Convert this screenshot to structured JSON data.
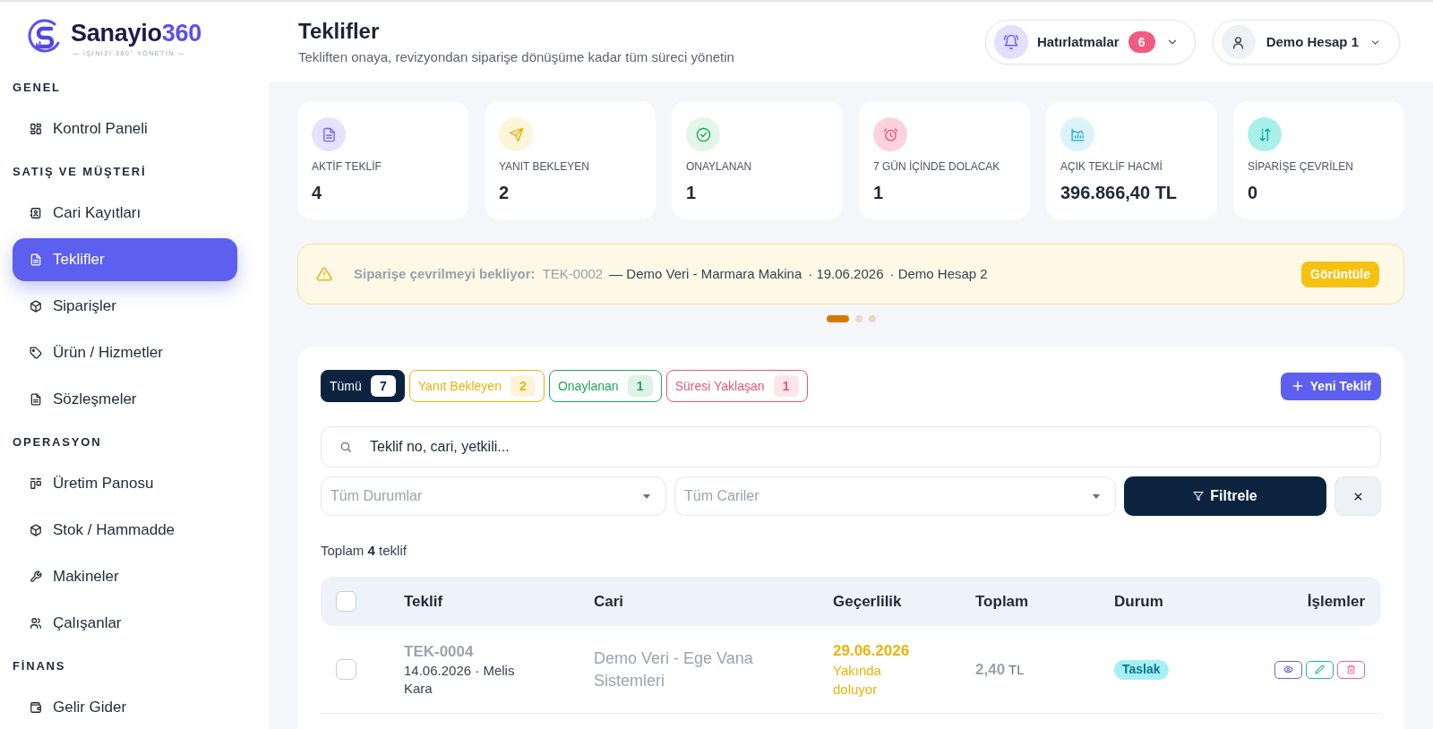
{
  "sidebar": {
    "logo": {
      "name": "Sanayio",
      "accent": "360",
      "tagline": "— İŞİNİZİ 360° YÖNETİN —"
    },
    "sections": [
      {
        "title": "GENEL",
        "items": [
          {
            "label": "Kontrol Paneli",
            "selected": false
          }
        ]
      },
      {
        "title": "SATIŞ VE MÜŞTERİ",
        "items": [
          {
            "label": "Cari Kayıtları",
            "selected": false
          },
          {
            "label": "Teklifler",
            "selected": true
          },
          {
            "label": "Siparişler",
            "selected": false
          },
          {
            "label": "Ürün / Hizmetler",
            "selected": false
          },
          {
            "label": "Sözleşmeler",
            "selected": false
          }
        ]
      },
      {
        "title": "OPERASYON",
        "items": [
          {
            "label": "Üretim Panosu",
            "selected": false
          },
          {
            "label": "Stok / Hammadde",
            "selected": false
          },
          {
            "label": "Makineler",
            "selected": false
          },
          {
            "label": "Çalışanlar",
            "selected": false
          }
        ]
      },
      {
        "title": "FİNANS",
        "items": [
          {
            "label": "Gelir Gider",
            "selected": false
          }
        ]
      }
    ]
  },
  "header": {
    "title": "Teklifler",
    "subtitle": "Tekliften onaya, revizyondan siparişe dönüşüme kadar tüm süreci yönetin",
    "reminders": {
      "label": "Hatırlatmalar",
      "count": "6"
    },
    "account": {
      "label": "Demo Hesap 1"
    }
  },
  "stats": [
    {
      "label": "AKTİF TEKLİF",
      "value": "4"
    },
    {
      "label": "YANIT BEKLEYEN",
      "value": "2"
    },
    {
      "label": "ONAYLANAN",
      "value": "1"
    },
    {
      "label": "7 GÜN İÇİNDE DOLACAK",
      "value": "1"
    },
    {
      "label": "AÇIK TEKLİF HACMİ",
      "value": "396.866,40 TL"
    },
    {
      "label": "SİPARİŞE ÇEVRİLEN",
      "value": "0"
    }
  ],
  "banner": {
    "label": "Siparişe çevrilmeyi bekliyor:",
    "code": "TEK-0002",
    "details": [
      "— Demo Veri - Marmara Makina",
      "· 19.06.2026",
      "· Demo Hesap 2"
    ],
    "button": "Görüntüle"
  },
  "carousel": {
    "dots": [
      {
        "selected": true
      },
      {
        "selected": false
      },
      {
        "selected": false
      }
    ]
  },
  "filters": {
    "tabs": [
      {
        "label": "Tümü",
        "count": "7",
        "selected": true,
        "color": "#0c2340"
      },
      {
        "label": "Yanıt Bekleyen",
        "count": "2",
        "selected": false,
        "color": "#eab308"
      },
      {
        "label": "Onaylanan",
        "count": "1",
        "selected": false,
        "color": "#22a55b"
      },
      {
        "label": "Süresi Yaklaşan",
        "count": "1",
        "selected": false,
        "color": "#e5567a"
      }
    ],
    "new_button": "Yeni Teklif",
    "search": {
      "placeholder": "Teklif no, cari, yetkili..."
    },
    "selects": [
      {
        "value": "Tüm Durumlar"
      },
      {
        "value": "Tüm Cariler"
      }
    ],
    "filter_button": "Filtrele"
  },
  "summary": "Toplam **4** teklif",
  "table": {
    "header_checkbox": {
      "checked": false
    },
    "columns": [
      "Teklif",
      "Cari",
      "Geçerlilik",
      "Toplam",
      "Durum",
      "İşlemler"
    ],
    "rows": [
      {
        "checked": false,
        "code": "TEK-0004",
        "meta": "14.06.2026 · Melis Kara",
        "customer": "Demo Veri - Ege Vana Sistemleri",
        "valid_until": "29.06.2026",
        "validity_note": "Yakında doluyor",
        "total": "**2,40** TL",
        "status": "Taslak"
      }
    ]
  }
}
